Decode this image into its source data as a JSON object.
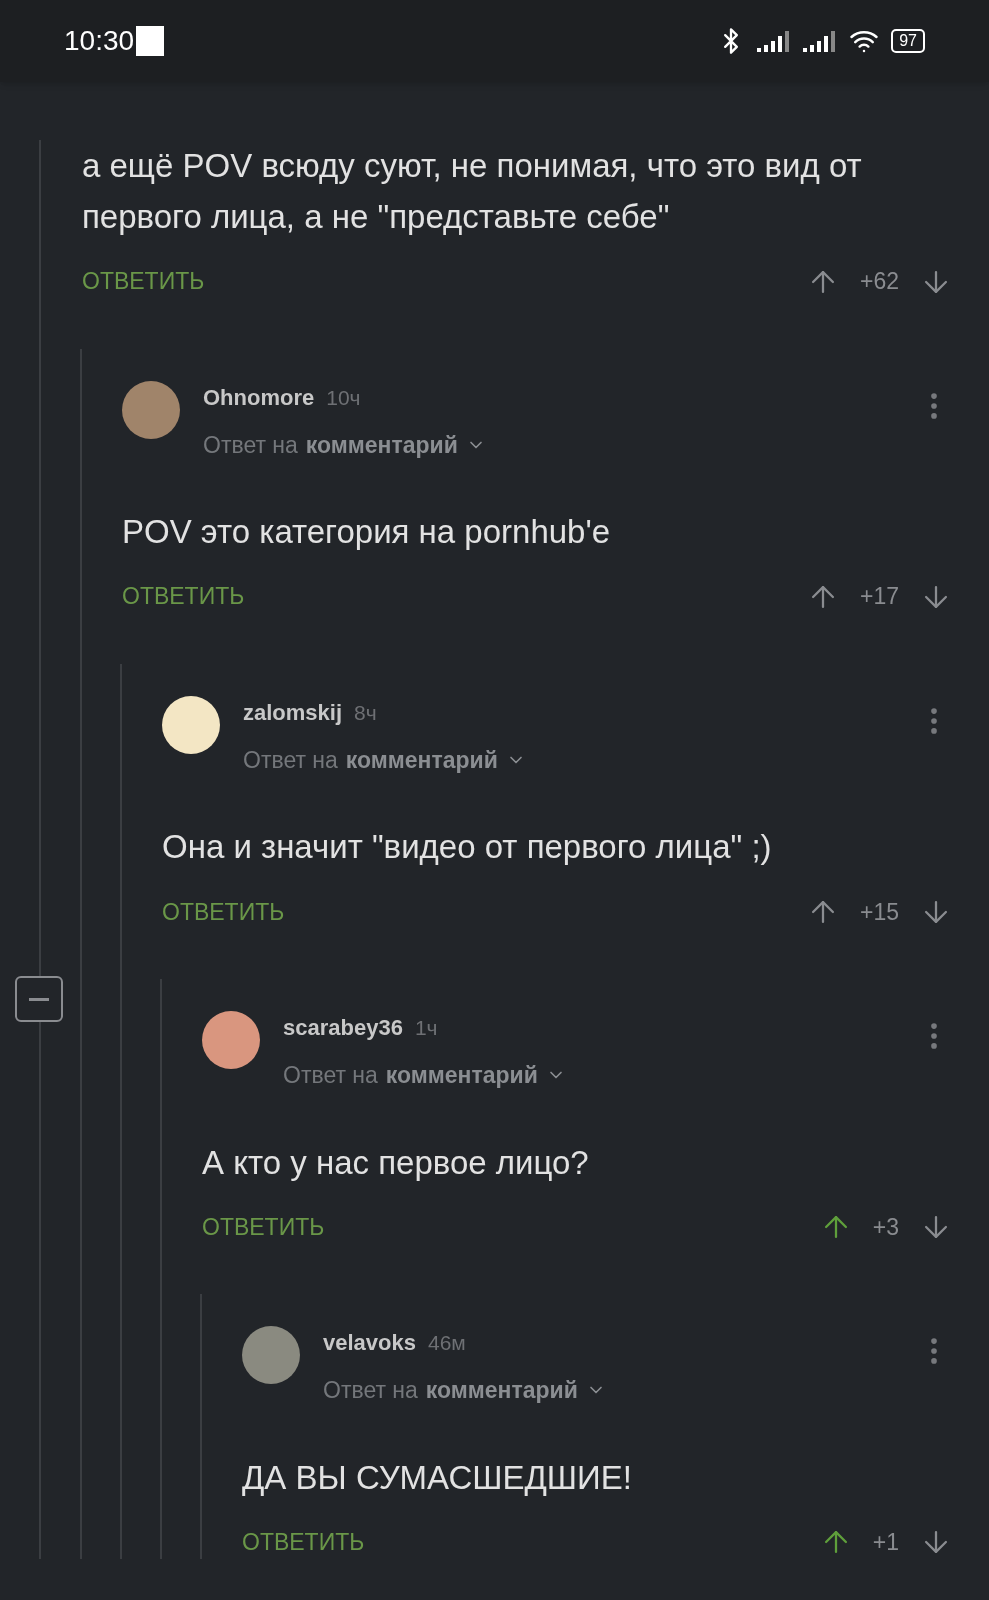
{
  "status_bar": {
    "time": "10:30",
    "battery": "97"
  },
  "comment": {
    "body": "а ещё POV всюду суют, не понимая, что это вид от первого лица, а не \"представьте себе\"",
    "reply_label": "ОТВЕТИТЬ",
    "score": "+62",
    "voted_up": false,
    "children": [
      {
        "author": "Ohnomore",
        "time": "10ч",
        "reply_prefix": "Ответ на",
        "reply_target": "комментарий",
        "color": "#a0846a",
        "body": "POV это категория на pornhub'e",
        "reply_label": "ОТВЕТИТЬ",
        "score": "+17",
        "voted_up": false,
        "children": [
          {
            "author": "zalomskij",
            "time": "8ч",
            "reply_prefix": "Ответ на",
            "reply_target": "комментарий",
            "color": "#f3e6c4",
            "body": "Она и значит \"видео от первого лица\" ;)",
            "reply_label": "ОТВЕТИТЬ",
            "score": "+15",
            "voted_up": false,
            "children": [
              {
                "author": "scarabey36",
                "time": "1ч",
                "reply_prefix": "Ответ на",
                "reply_target": "комментарий",
                "color": "#d9967f",
                "body": "А кто у нас первое лицо?",
                "reply_label": "ОТВЕТИТЬ",
                "score": "+3",
                "voted_up": true,
                "children": [
                  {
                    "author": "velavoks",
                    "time": "46м",
                    "reply_prefix": "Ответ на",
                    "reply_target": "комментарий",
                    "color": "#8a8a80",
                    "body": "ДА ВЫ СУМАСШЕДШИЕ!",
                    "reply_label": "ОТВЕТИТЬ",
                    "score": "+1",
                    "voted_up": true
                  }
                ]
              }
            ]
          }
        ]
      }
    ]
  }
}
